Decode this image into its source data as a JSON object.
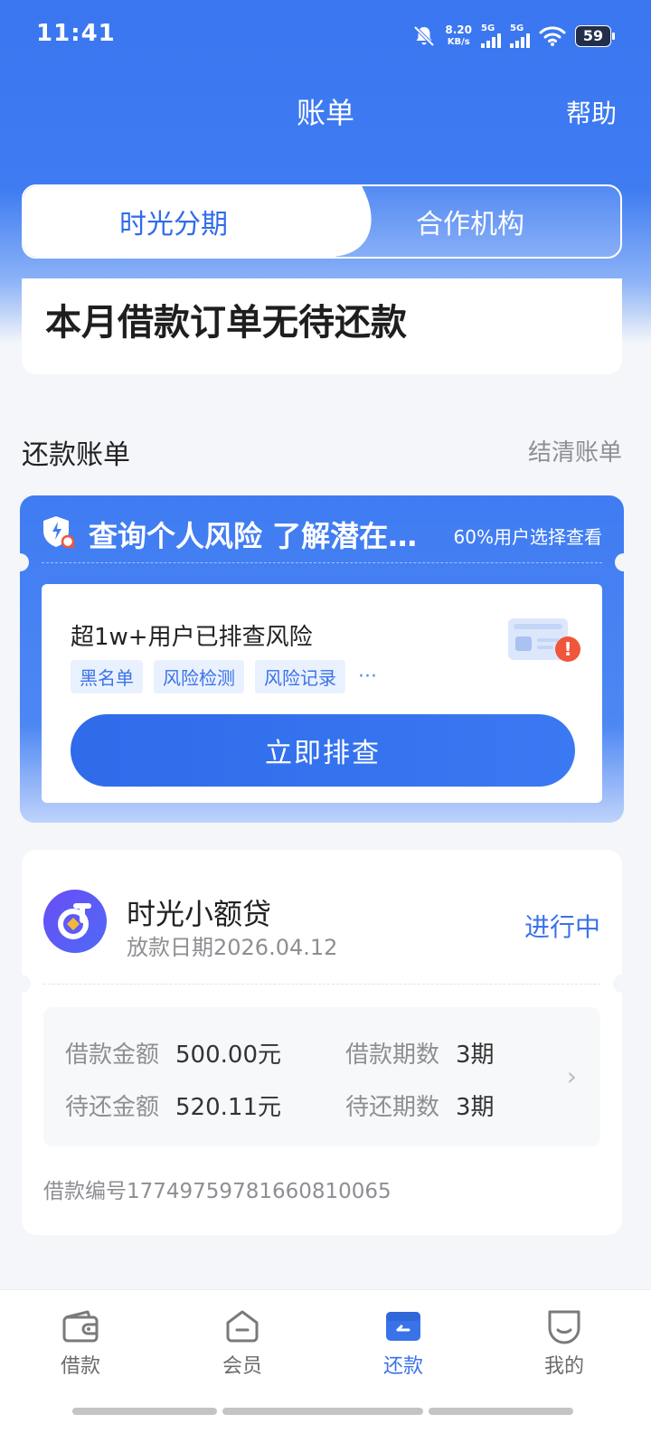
{
  "status": {
    "time": "11:41",
    "speed_value": "8.20",
    "speed_unit": "KB/s",
    "net1": "5G",
    "net2": "5G",
    "battery": "59"
  },
  "header": {
    "title": "账单",
    "help": "帮助"
  },
  "tabs": [
    {
      "label": "时光分期",
      "active": true
    },
    {
      "label": "合作机构",
      "active": false
    }
  ],
  "month_status": "本月借款订单无待还款",
  "section": {
    "title": "还款账单",
    "link": "结清账单"
  },
  "risk": {
    "title": "查询个人风险 了解潜在…",
    "subtitle": "60%用户选择查看",
    "inner_title": "超1w+用户已排查风险",
    "chips": [
      "黑名单",
      "风险检测",
      "风险记录"
    ],
    "more": "···",
    "button": "立即排查"
  },
  "loan": {
    "name": "时光小额贷",
    "date": "放款日期2026.04.12",
    "status": "进行中",
    "details": [
      {
        "label": "借款金额",
        "value": "500.00元"
      },
      {
        "label": "借款期数",
        "value": "3期"
      },
      {
        "label": "待还金额",
        "value": "520.11元"
      },
      {
        "label": "待还期数",
        "value": "3期"
      }
    ],
    "loan_no": "借款编号17749759781660810065"
  },
  "nav": [
    {
      "label": "借款",
      "icon": "wallet-icon",
      "active": false
    },
    {
      "label": "会员",
      "icon": "basket-icon",
      "active": false
    },
    {
      "label": "还款",
      "icon": "repay-card-icon",
      "active": true
    },
    {
      "label": "我的",
      "icon": "smile-icon",
      "active": false
    }
  ],
  "colors": {
    "brand": "#3A76F0",
    "accent_text": "#3A73E8",
    "alert": "#F0563C"
  }
}
